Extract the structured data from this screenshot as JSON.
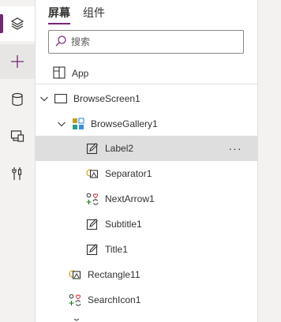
{
  "tabs": [
    {
      "label": "屏幕",
      "active": true
    },
    {
      "label": "组件",
      "active": false
    }
  ],
  "search": {
    "placeholder": "搜索"
  },
  "app": {
    "label": "App"
  },
  "tree": {
    "browse_screen": "BrowseScreen1",
    "browse_gallery": "BrowseGallery1",
    "label2": "Label2",
    "separator1": "Separator1",
    "next_arrow1": "NextArrow1",
    "subtitle1": "Subtitle1",
    "title1": "Title1",
    "rectangle11": "Rectangle11",
    "search_icon1": "SearchIcon1",
    "more": "···"
  },
  "rail_icons": [
    "layers-icon",
    "plus-icon",
    "database-icon",
    "media-icon",
    "tools-icon"
  ],
  "colors": {
    "accent": "#742774",
    "selected_row": "#dedede",
    "rail": "#f3f2f1"
  }
}
